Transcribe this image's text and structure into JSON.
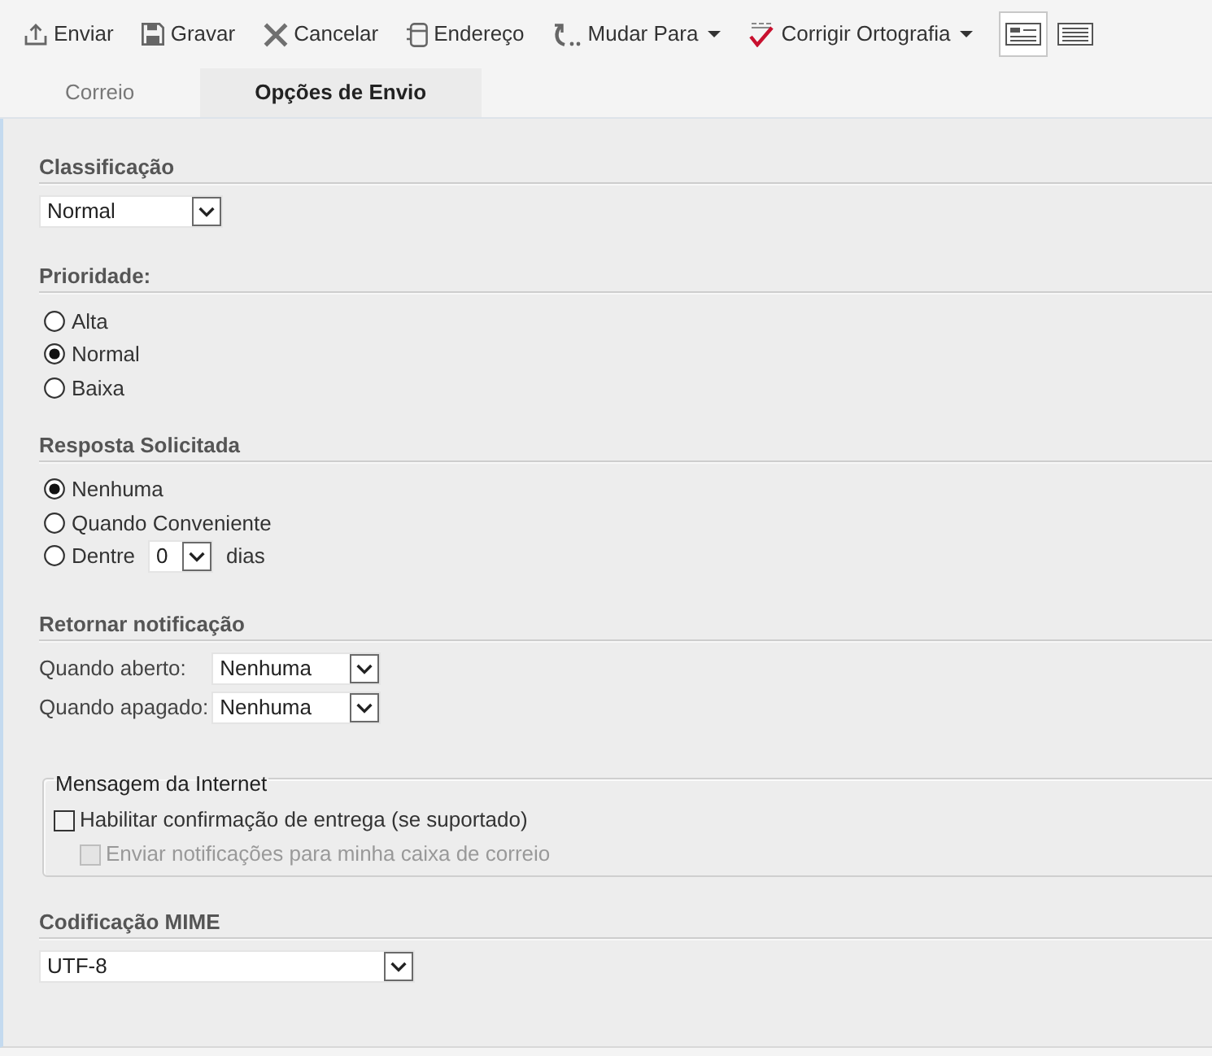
{
  "toolbar": {
    "items": [
      {
        "label": "Enviar",
        "dropdown": false
      },
      {
        "label": "Gravar",
        "dropdown": false
      },
      {
        "label": "Cancelar",
        "dropdown": false
      },
      {
        "label": "Endereço",
        "dropdown": false
      },
      {
        "label": "Mudar Para",
        "dropdown": true
      },
      {
        "label": "Corrigir Ortografia",
        "dropdown": true
      }
    ],
    "view_buttons": [
      {
        "selected": true
      },
      {
        "selected": false
      }
    ]
  },
  "tabs": [
    {
      "label": "Correio",
      "selected": false
    },
    {
      "label": "Opções de Envio",
      "selected": true
    }
  ],
  "sections": [
    {
      "kind": "select",
      "title": "Classificação",
      "value": "Normal"
    },
    {
      "kind": "radios",
      "title": "Prioridade:",
      "options": [
        {
          "label": "Alta",
          "selected": false
        },
        {
          "label": "Normal",
          "selected": true
        },
        {
          "label": "Baixa",
          "selected": false
        }
      ]
    },
    {
      "kind": "radios",
      "title": "Resposta Solicitada",
      "options": [
        {
          "label": "Nenhuma",
          "selected": true
        },
        {
          "label": "Quando Conveniente",
          "selected": false
        },
        {
          "label": "Dentre",
          "selected": false,
          "days": {
            "value": "0",
            "unit": "dias"
          }
        }
      ]
    },
    {
      "kind": "fields",
      "title": "Retornar notificação",
      "fields": [
        {
          "label": "Quando aberto:",
          "value": "Nenhuma"
        },
        {
          "label": "Quando apagado:",
          "value": "Nenhuma"
        }
      ]
    },
    {
      "kind": "group",
      "title": "Mensagem da Internet",
      "checkboxes": [
        {
          "label": "Habilitar confirmação de entrega (se suportado)",
          "checked": false,
          "disabled": false,
          "children": [
            {
              "label": "Enviar notificações para minha caixa de correio",
              "checked": false,
              "disabled": true
            }
          ]
        }
      ]
    },
    {
      "kind": "select",
      "title": "Codificação MIME",
      "value": "UTF-8"
    }
  ]
}
